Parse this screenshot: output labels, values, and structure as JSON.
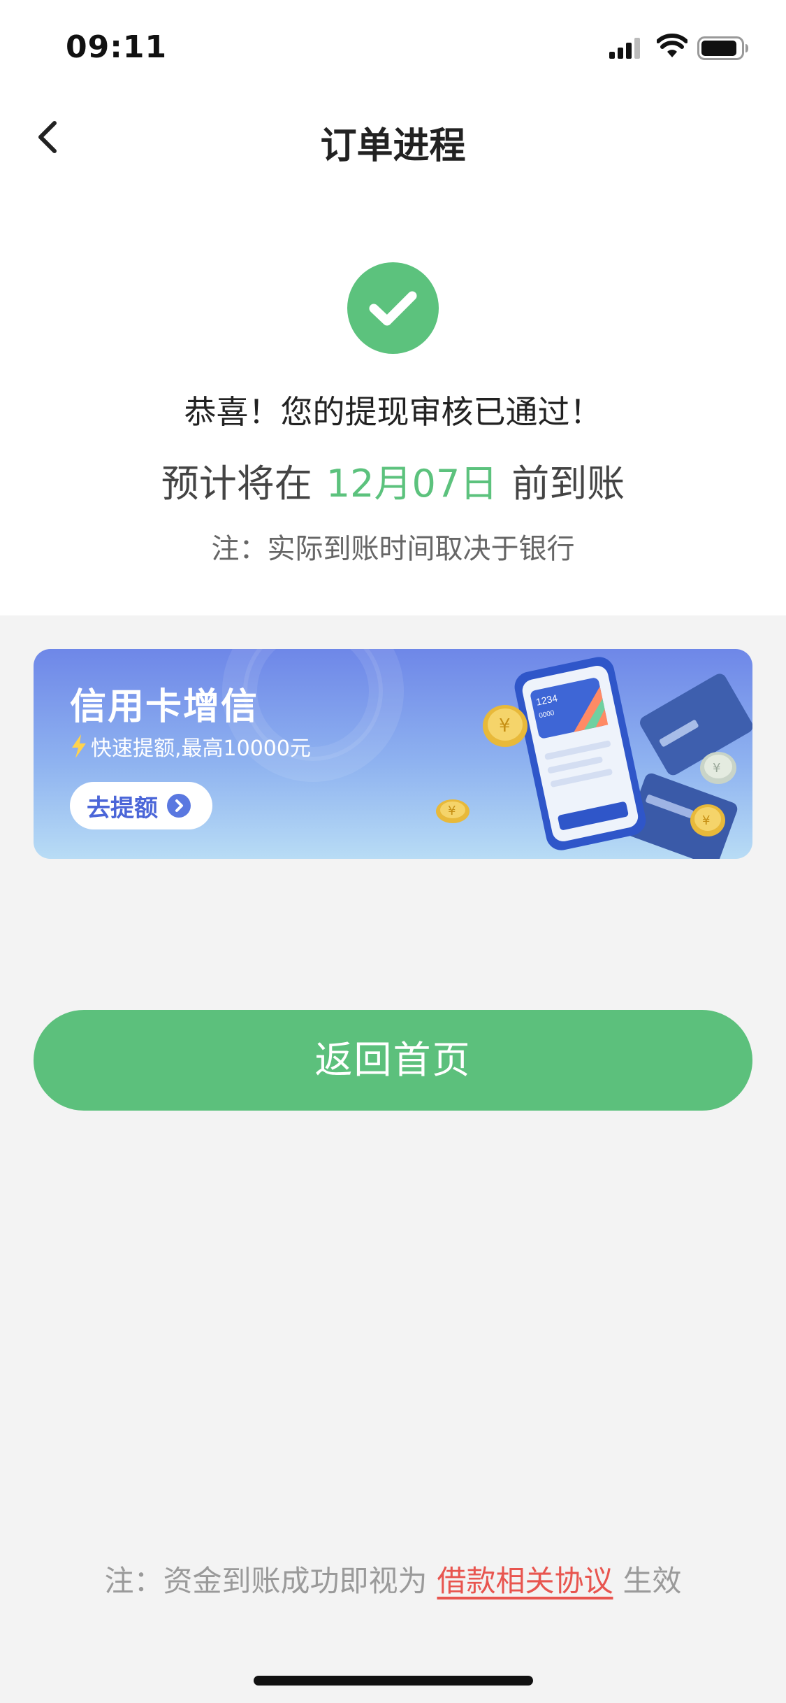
{
  "status_bar": {
    "time": "09:11"
  },
  "nav": {
    "title": "订单进程",
    "back_icon": "chevron-left-icon"
  },
  "result": {
    "icon": "check-circle-icon",
    "title": "恭喜！您的提现审核已通过！",
    "arrival_prefix": "预计将在",
    "arrival_date": "12月07日",
    "arrival_suffix": "前到账",
    "note": "注：实际到账时间取决于银行"
  },
  "banner": {
    "title": "信用卡增信",
    "subtitle": "快速提额,最高10000元",
    "button_label": "去提额",
    "phone_card_number": "1234",
    "phone_card_sub": "0000"
  },
  "actions": {
    "home_button": "返回首页"
  },
  "footer": {
    "prefix": "注：资金到账成功即视为",
    "link": "借款相关协议",
    "suffix": "生效"
  },
  "colors": {
    "accent_green": "#5cc27d",
    "link_red": "#e8554f",
    "banner_blue": "#6e87e8"
  }
}
